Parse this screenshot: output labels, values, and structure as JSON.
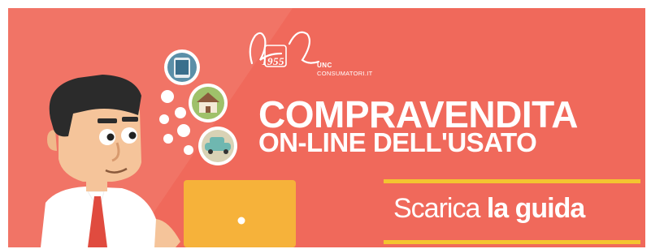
{
  "logo": {
    "year": "1955",
    "org": "UNC",
    "site": "CONSUMATORI.IT"
  },
  "headline": {
    "line1": "COMPRAVENDITA",
    "line2": "ON-LINE DELL'USATO"
  },
  "cta": {
    "prefix": "Scarica",
    "emphasis": "la guida"
  },
  "colors": {
    "background": "#f0695b",
    "accent_yellow": "#f4c430",
    "laptop": "#f6b23a"
  },
  "icons": [
    "smartphone-icon",
    "house-icon",
    "car-icon"
  ]
}
